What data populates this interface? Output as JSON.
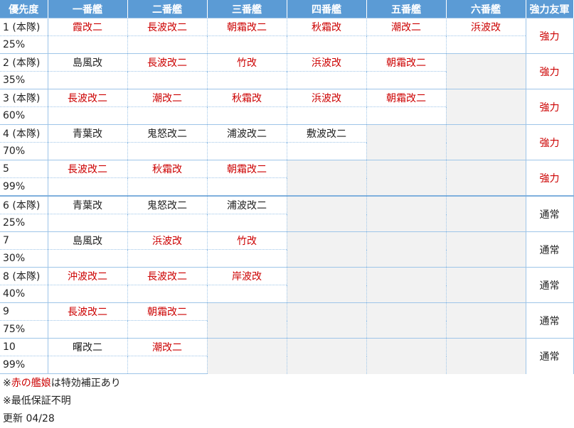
{
  "headers": [
    "優先度",
    "一番艦",
    "二番艦",
    "三番艦",
    "四番艦",
    "五番艦",
    "六番艦",
    "強力友軍"
  ],
  "rows": [
    {
      "priority": "1 (本隊)",
      "rate": "25%",
      "ships": [
        {
          "n": "霞改二",
          "r": true
        },
        {
          "n": "長波改二",
          "r": true
        },
        {
          "n": "朝霜改二",
          "r": true
        },
        {
          "n": "秋霜改",
          "r": true
        },
        {
          "n": "潮改二",
          "r": true
        },
        {
          "n": "浜波改",
          "r": true
        }
      ],
      "strength": "強力"
    },
    {
      "priority": "2 (本隊)",
      "rate": "35%",
      "ships": [
        {
          "n": "島風改",
          "r": false
        },
        {
          "n": "長波改二",
          "r": true
        },
        {
          "n": "竹改",
          "r": true
        },
        {
          "n": "浜波改",
          "r": true
        },
        {
          "n": "朝霜改二",
          "r": true
        }
      ],
      "strength": "強力"
    },
    {
      "priority": "3 (本隊)",
      "rate": "60%",
      "ships": [
        {
          "n": "長波改二",
          "r": true
        },
        {
          "n": "潮改二",
          "r": true
        },
        {
          "n": "秋霜改",
          "r": true
        },
        {
          "n": "浜波改",
          "r": true
        },
        {
          "n": "朝霜改二",
          "r": true
        }
      ],
      "strength": "強力"
    },
    {
      "priority": "4 (本隊)",
      "rate": "70%",
      "ships": [
        {
          "n": "青葉改",
          "r": false
        },
        {
          "n": "鬼怒改二",
          "r": false
        },
        {
          "n": "浦波改二",
          "r": false
        },
        {
          "n": "敷波改二",
          "r": false
        }
      ],
      "strength": "強力"
    },
    {
      "priority": "5",
      "rate": "99%",
      "ships": [
        {
          "n": "長波改二",
          "r": true
        },
        {
          "n": "秋霜改",
          "r": true
        },
        {
          "n": "朝霜改二",
          "r": true
        }
      ],
      "strength": "強力"
    },
    {
      "priority": "6 (本隊)",
      "rate": "25%",
      "ships": [
        {
          "n": "青葉改",
          "r": false
        },
        {
          "n": "鬼怒改二",
          "r": false
        },
        {
          "n": "浦波改二",
          "r": false
        }
      ],
      "strength": "通常"
    },
    {
      "priority": "7",
      "rate": "30%",
      "ships": [
        {
          "n": "島風改",
          "r": false
        },
        {
          "n": "浜波改",
          "r": true
        },
        {
          "n": "竹改",
          "r": true
        }
      ],
      "strength": "通常"
    },
    {
      "priority": "8 (本隊)",
      "rate": "40%",
      "ships": [
        {
          "n": "沖波改二",
          "r": true
        },
        {
          "n": "長波改二",
          "r": true
        },
        {
          "n": "岸波改",
          "r": true
        }
      ],
      "strength": "通常"
    },
    {
      "priority": "9",
      "rate": "75%",
      "ships": [
        {
          "n": "長波改二",
          "r": true
        },
        {
          "n": "朝霜改二",
          "r": true
        }
      ],
      "strength": "通常"
    },
    {
      "priority": "10",
      "rate": "99%",
      "ships": [
        {
          "n": "曙改二",
          "r": false
        },
        {
          "n": "潮改二",
          "r": true
        }
      ],
      "strength": "通常"
    }
  ],
  "notes": {
    "prefix": "※",
    "red": "赤の艦娘",
    "suffix": "は特効補正あり",
    "line2": "※最低保証不明",
    "line3": "更新 04/28"
  },
  "colors": {
    "header": "#5b9bd5",
    "red": "#c00000",
    "empty": "#f2f2f2"
  }
}
